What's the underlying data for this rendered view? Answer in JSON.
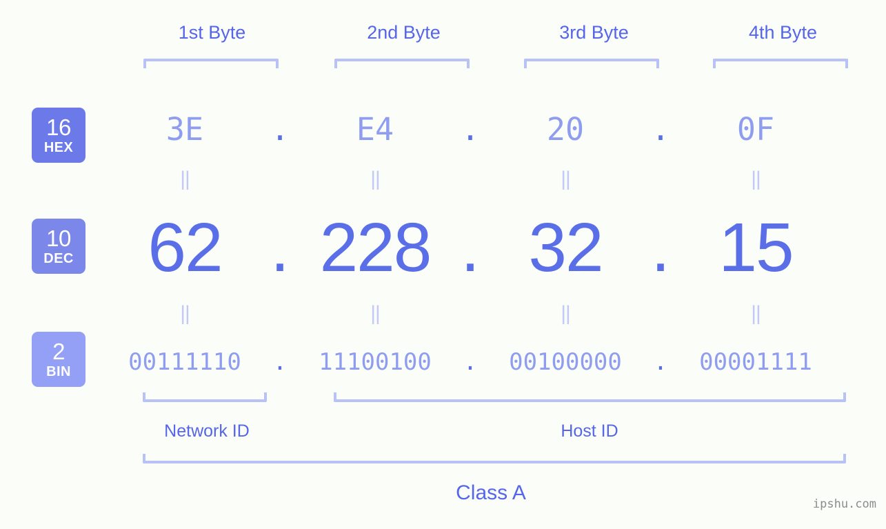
{
  "page": {
    "background_color": "#fbfdf8",
    "watermark": "ipshu.com"
  },
  "colors": {
    "accent_strong": "#5a6ee8",
    "accent_label": "#5566e8",
    "accent_light": "#8f9df0",
    "bracket": "#b9c2f7",
    "equals": "#c3caf8",
    "badge_hex": "#6b7ae8",
    "badge_dec": "#7b88ea",
    "badge_bin": "#93a0f5",
    "watermark": "#8c8c8c"
  },
  "byte_headers": [
    {
      "label": "1st Byte"
    },
    {
      "label": "2nd Byte"
    },
    {
      "label": "3rd Byte"
    },
    {
      "label": "4th Byte"
    }
  ],
  "bases": [
    {
      "id": "hex",
      "number": "16",
      "name": "HEX",
      "color": "#6b7ae8"
    },
    {
      "id": "dec",
      "number": "10",
      "name": "DEC",
      "color": "#7b88ea"
    },
    {
      "id": "bin",
      "number": "2",
      "name": "BIN",
      "color": "#93a0f5"
    }
  ],
  "separator": ".",
  "equals_glyph": "||",
  "rows": {
    "hex": {
      "label": "HEX",
      "values": [
        "3E",
        "E4",
        "20",
        "0F"
      ]
    },
    "dec": {
      "label": "DEC",
      "values": [
        "62",
        "228",
        "32",
        "15"
      ]
    },
    "bin": {
      "label": "BIN",
      "values": [
        "00111110",
        "11100100",
        "00100000",
        "00001111"
      ]
    }
  },
  "ip_address": "62.228.32.15",
  "segments": {
    "network_id": {
      "label": "Network ID",
      "bytes": 1
    },
    "host_id": {
      "label": "Host ID",
      "bytes": 3
    }
  },
  "class": {
    "label": "Class A"
  }
}
